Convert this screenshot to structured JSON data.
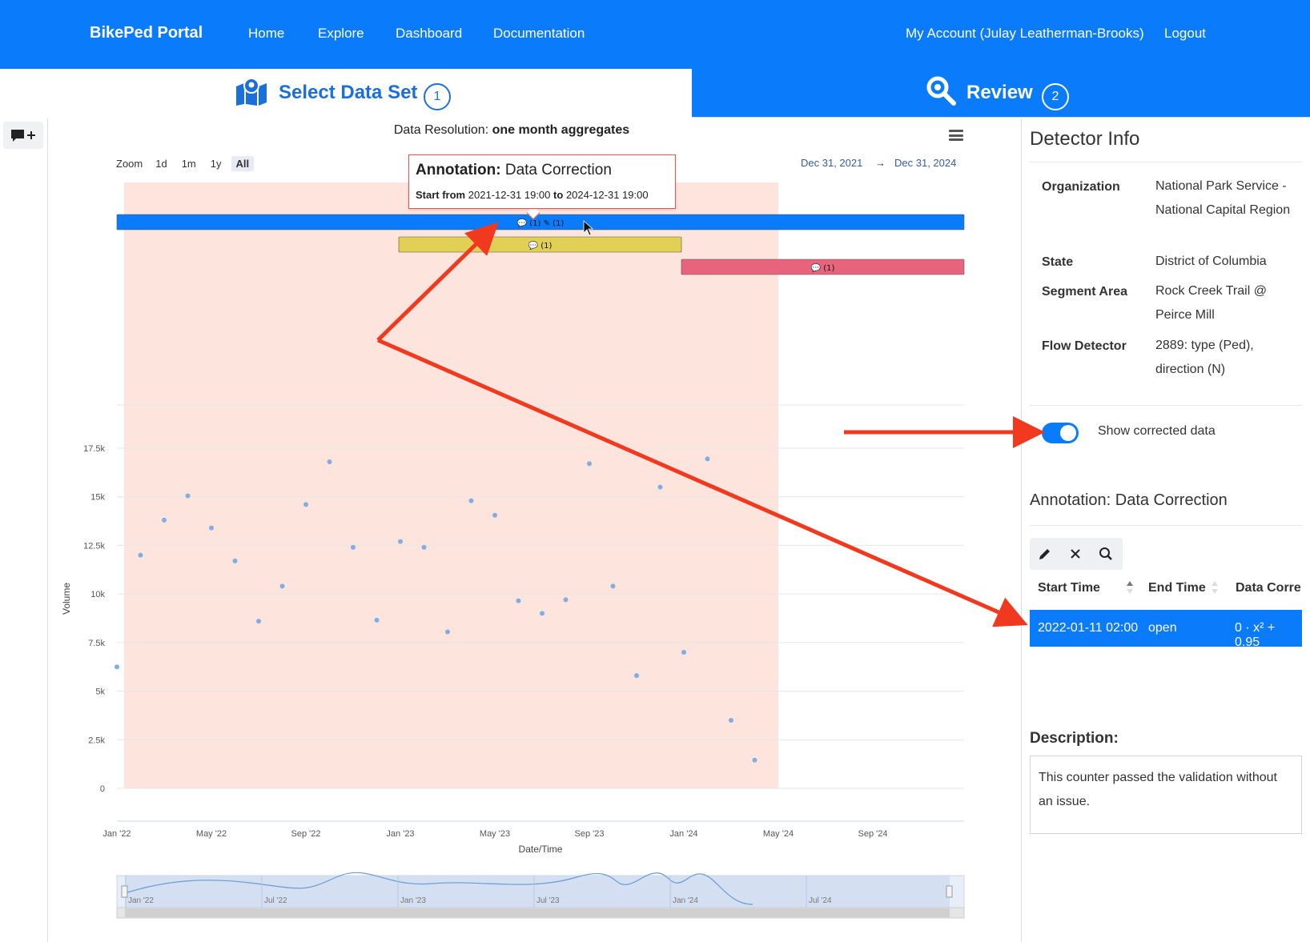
{
  "nav": {
    "brand": "BikePed Portal",
    "links": [
      "Home",
      "Explore",
      "Dashboard",
      "Documentation"
    ],
    "account": "My Account (Julay Leatherman-Brooks)",
    "logout": "Logout"
  },
  "steps": {
    "select": {
      "label": "Select Data Set",
      "num": "1"
    },
    "review": {
      "label": "Review",
      "num": "2"
    }
  },
  "chart": {
    "resolution_prefix": "Data Resolution: ",
    "resolution_value": "one month aggregates",
    "zoom_label": "Zoom",
    "zoom_buttons": [
      "1d",
      "1m",
      "1y",
      "All"
    ],
    "range_from": "Dec 31, 2021",
    "range_arrow": "→",
    "range_to": "Dec 31, 2024",
    "tooltip": {
      "title_bold": "Annotation:",
      "title_rest": " Data Correction",
      "start_label": "Start from",
      "start_value": "2021-12-31 19:00",
      "to_label": "to",
      "end_value": "2024-12-31 19:00"
    }
  },
  "chart_data": {
    "type": "scatter",
    "xlabel": "Date/Time",
    "ylabel": "Volume",
    "ylim": [
      0,
      17500
    ],
    "yticks": [
      "0",
      "2.5k",
      "5k",
      "7.5k",
      "10k",
      "12.5k",
      "15k",
      "17.5k"
    ],
    "xticks": [
      "Jan '22",
      "May '22",
      "Sep '22",
      "Jan '23",
      "May '23",
      "Sep '23",
      "Jan '24",
      "May '24",
      "Sep '24"
    ],
    "navigator_labels": [
      "Jan '22",
      "Jul '22",
      "Jan '23",
      "Jul '23",
      "Jan '24",
      "Jul '24"
    ],
    "points": [
      {
        "x": "2022-01",
        "y": 6250
      },
      {
        "x": "2022-02",
        "y": 12000
      },
      {
        "x": "2022-03",
        "y": 13800
      },
      {
        "x": "2022-04",
        "y": 15050
      },
      {
        "x": "2022-05",
        "y": 13400
      },
      {
        "x": "2022-06",
        "y": 11700
      },
      {
        "x": "2022-07",
        "y": 8600
      },
      {
        "x": "2022-08",
        "y": 10400
      },
      {
        "x": "2022-09",
        "y": 14600
      },
      {
        "x": "2022-10",
        "y": 16800
      },
      {
        "x": "2022-11",
        "y": 12400
      },
      {
        "x": "2022-12",
        "y": 8650
      },
      {
        "x": "2023-01",
        "y": 12700
      },
      {
        "x": "2023-02",
        "y": 12400
      },
      {
        "x": "2023-03",
        "y": 8050
      },
      {
        "x": "2023-04",
        "y": 14800
      },
      {
        "x": "2023-05",
        "y": 14050
      },
      {
        "x": "2023-06",
        "y": 9650
      },
      {
        "x": "2023-07",
        "y": 9000
      },
      {
        "x": "2023-08",
        "y": 9700
      },
      {
        "x": "2023-09",
        "y": 16700
      },
      {
        "x": "2023-10",
        "y": 10400
      },
      {
        "x": "2023-11",
        "y": 5800
      },
      {
        "x": "2023-12",
        "y": 15500
      },
      {
        "x": "2024-01",
        "y": 7000
      },
      {
        "x": "2024-02",
        "y": 16950
      },
      {
        "x": "2024-03",
        "y": 3500
      },
      {
        "x": "2024-04",
        "y": 1450
      }
    ],
    "annotation_bars": [
      {
        "color": "#0a7bfa",
        "start": "2022-01",
        "end": "2024-12",
        "labels": [
          "💬 (1)",
          "✎ (1)"
        ]
      },
      {
        "color": "#e2cf55",
        "start": "2023-01",
        "end": "2023-12",
        "labels": [
          "💬 (1)"
        ]
      },
      {
        "color": "#e8647c",
        "start": "2024-01",
        "end": "2024-12",
        "labels": [
          "💬 (1)"
        ]
      }
    ],
    "highlight_band": {
      "start": "2022-01",
      "end": "2024-05",
      "color": "#fde4dd"
    }
  },
  "panel": {
    "title": "Detector Info",
    "info": [
      {
        "key": "Organization",
        "value": "National Park Service - National Capital Region"
      },
      {
        "key": "State",
        "value": "District of Columbia"
      },
      {
        "key": "Segment Area",
        "value": "Rock Creek Trail @ Peirce Mill"
      },
      {
        "key": "Flow Detector",
        "value": "2889: type (Ped), direction (N)"
      }
    ],
    "toggle_label": "Show corrected data",
    "toggle_on": true,
    "annotation_title": "Annotation: Data Correction",
    "table_headers": [
      "Start Time",
      "End Time",
      "Data Corre"
    ],
    "row": {
      "start": "2022-01-11 02:00",
      "end": "open",
      "formula": "0 · x² + 0.95"
    },
    "description_label": "Description:",
    "description": "This counter passed the validation without an issue."
  },
  "colors": {
    "brand_blue": "#0a7bfa",
    "annotation_red": "#f0391f",
    "point_blue": "#7eaee5"
  }
}
